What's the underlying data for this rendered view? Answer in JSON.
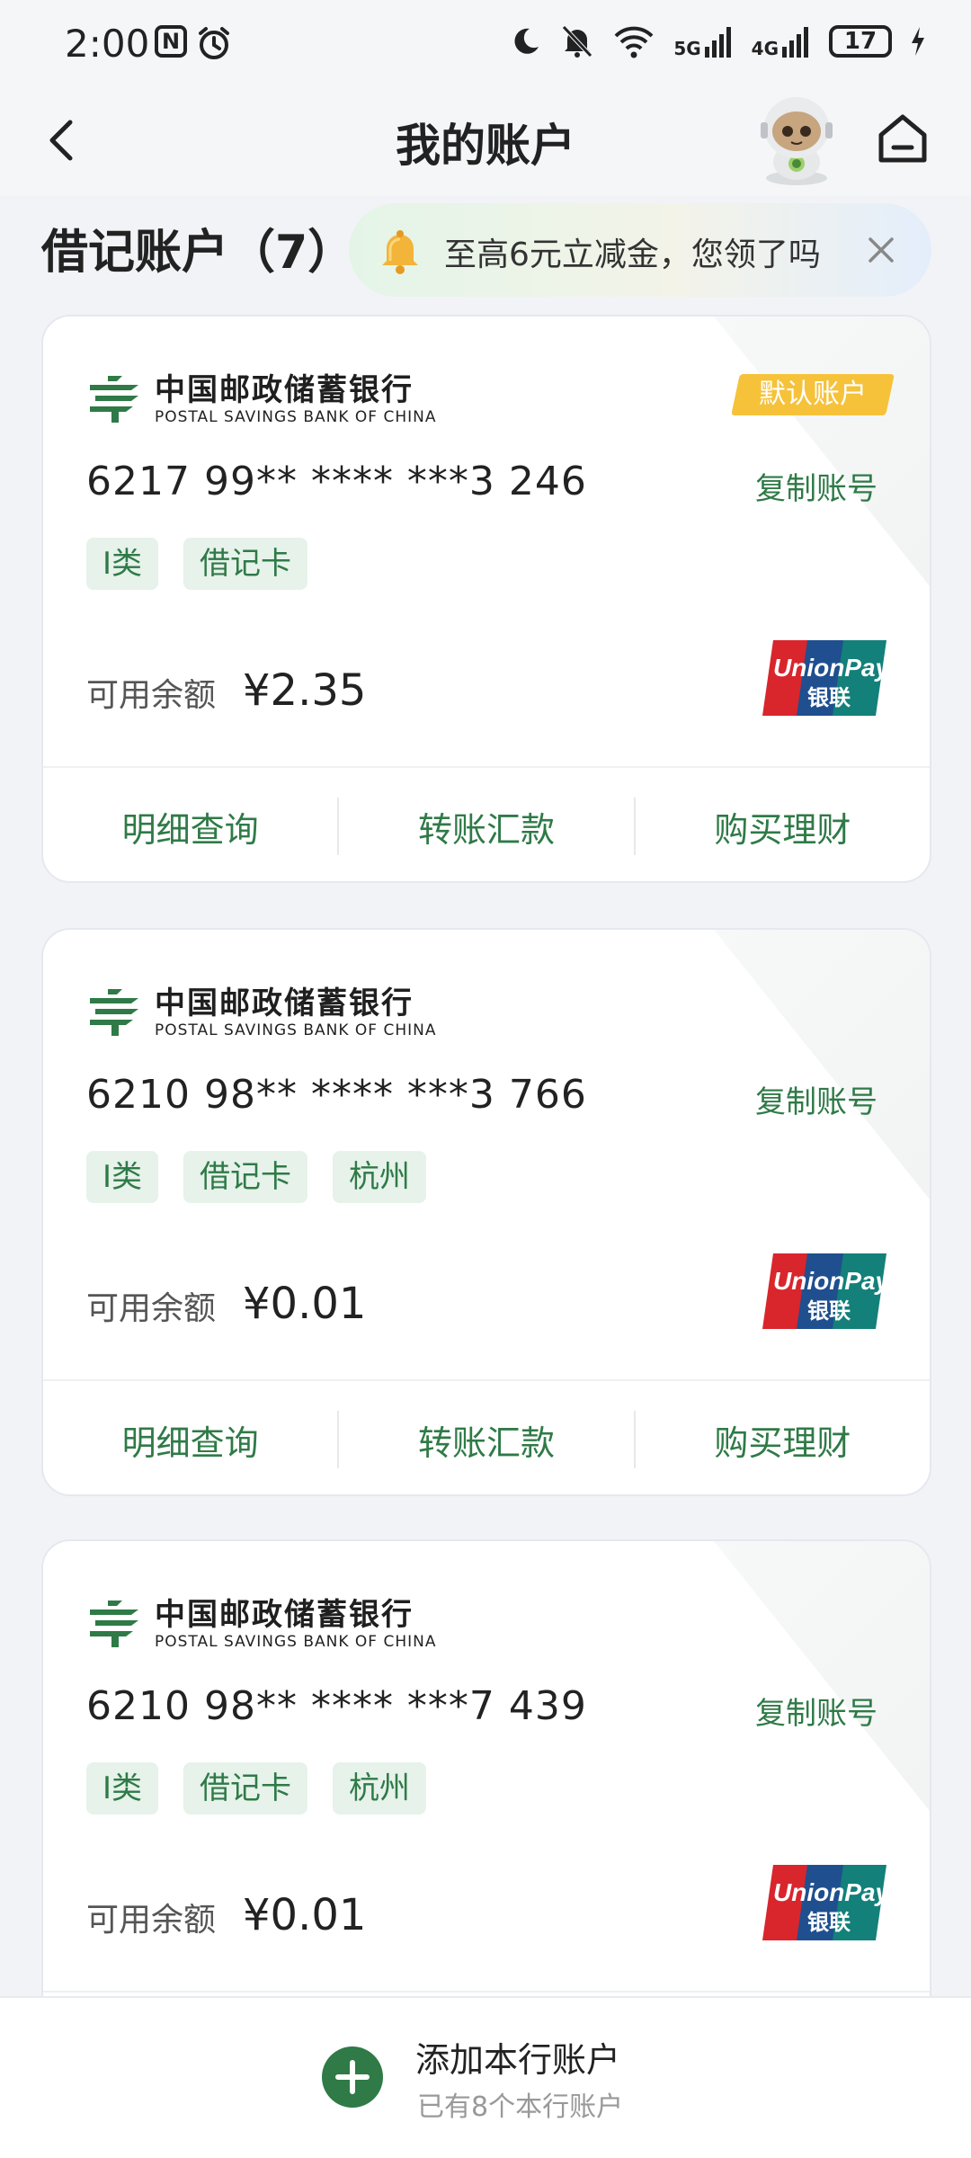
{
  "status_bar": {
    "time": "2:00",
    "notif_icon_n": "N",
    "signal_5g": "5G",
    "signal_4g": "4G",
    "wifi_level": "6",
    "battery": "17"
  },
  "header": {
    "title": "我的账户"
  },
  "section": {
    "title": "借记账户（7）"
  },
  "promo": {
    "text": "至高6元立减金，您领了吗"
  },
  "bank": {
    "name_cn": "中国邮政储蓄银行",
    "name_en": "POSTAL SAVINGS BANK OF CHINA"
  },
  "labels": {
    "default_badge": "默认账户",
    "copy": "复制账号",
    "balance_label": "可用余额",
    "action_detail": "明细查询",
    "action_transfer": "转账汇款",
    "action_wealth": "购买理财"
  },
  "cards": [
    {
      "number": "6217 99** **** ***3 246",
      "tags": [
        "I类",
        "借记卡"
      ],
      "balance": "¥2.35",
      "is_default": true
    },
    {
      "number": "6210 98** **** ***3 766",
      "tags": [
        "I类",
        "借记卡",
        "杭州"
      ],
      "balance": "¥0.01",
      "is_default": false
    },
    {
      "number": "6210 98** **** ***7 439",
      "tags": [
        "I类",
        "借记卡",
        "杭州"
      ],
      "balance": "¥0.01",
      "is_default": false
    }
  ],
  "bottom": {
    "add_title": "添加本行账户",
    "add_subtitle": "已有8个本行账户"
  },
  "colors": {
    "brand_green": "#2f7a47",
    "default_badge": "#f6c23a",
    "tag_bg": "#e6f2ea"
  },
  "icons": [
    "back-arrow-icon",
    "mascot-avatar",
    "home-icon",
    "bell-icon",
    "close-icon",
    "bank-logo-icon",
    "unionpay-logo",
    "add-circle-icon"
  ]
}
